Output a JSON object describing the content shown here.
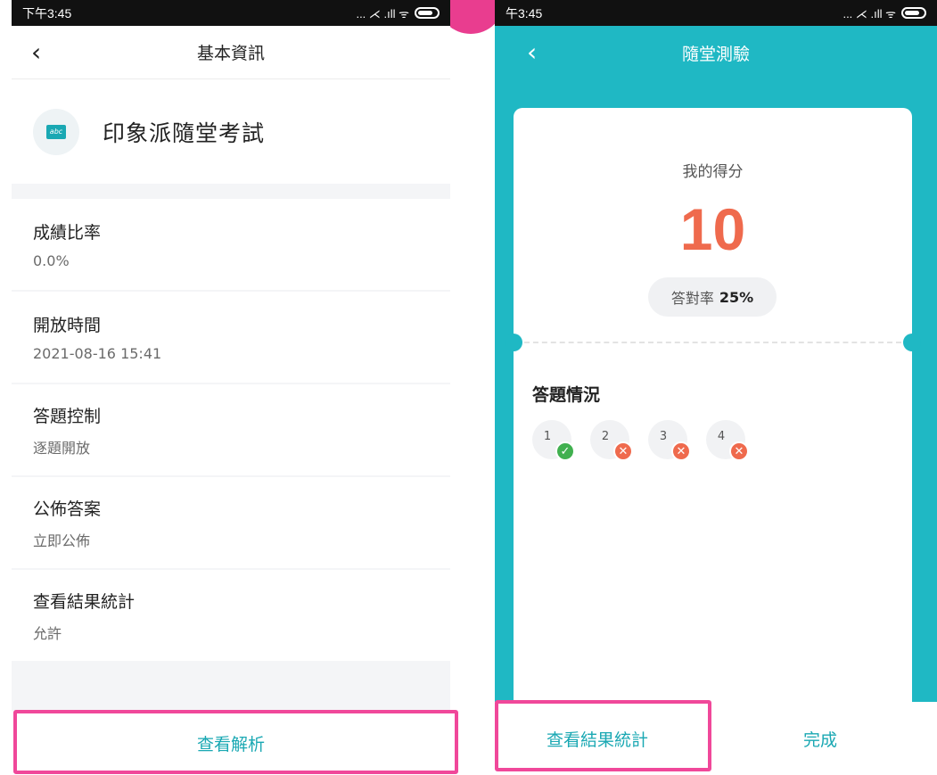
{
  "left": {
    "status": {
      "time": "下午3:45",
      "signal_text": "... ⋌ .ıll ᯤ"
    },
    "nav_title": "基本資訊",
    "quiz_icon_text": "abc",
    "quiz_title": "印象派隨堂考試",
    "info": [
      {
        "label": "成績比率",
        "value": "0.0%"
      },
      {
        "label": "開放時間",
        "value": "2021-08-16 15:41"
      },
      {
        "label": "答題控制",
        "value": "逐題開放"
      },
      {
        "label": "公佈答案",
        "value": "立即公佈"
      },
      {
        "label": "查看結果統計",
        "value": "允許"
      }
    ],
    "bottom_button": "查看解析"
  },
  "right": {
    "status": {
      "time": "午3:45",
      "signal_text": "... ⋌ .ıll ᯤ"
    },
    "nav_title": "隨堂測驗",
    "score_label": "我的得分",
    "score": "10",
    "rate_label": "答對率",
    "rate_value": "25%",
    "answer_title": "答題情況",
    "answers": [
      {
        "num": "1",
        "mark": "✓"
      },
      {
        "num": "2",
        "mark": "✕"
      },
      {
        "num": "3",
        "mark": "✕"
      },
      {
        "num": "4",
        "mark": "✕"
      }
    ],
    "stats_button": "查看結果統計",
    "done_button": "完成"
  }
}
